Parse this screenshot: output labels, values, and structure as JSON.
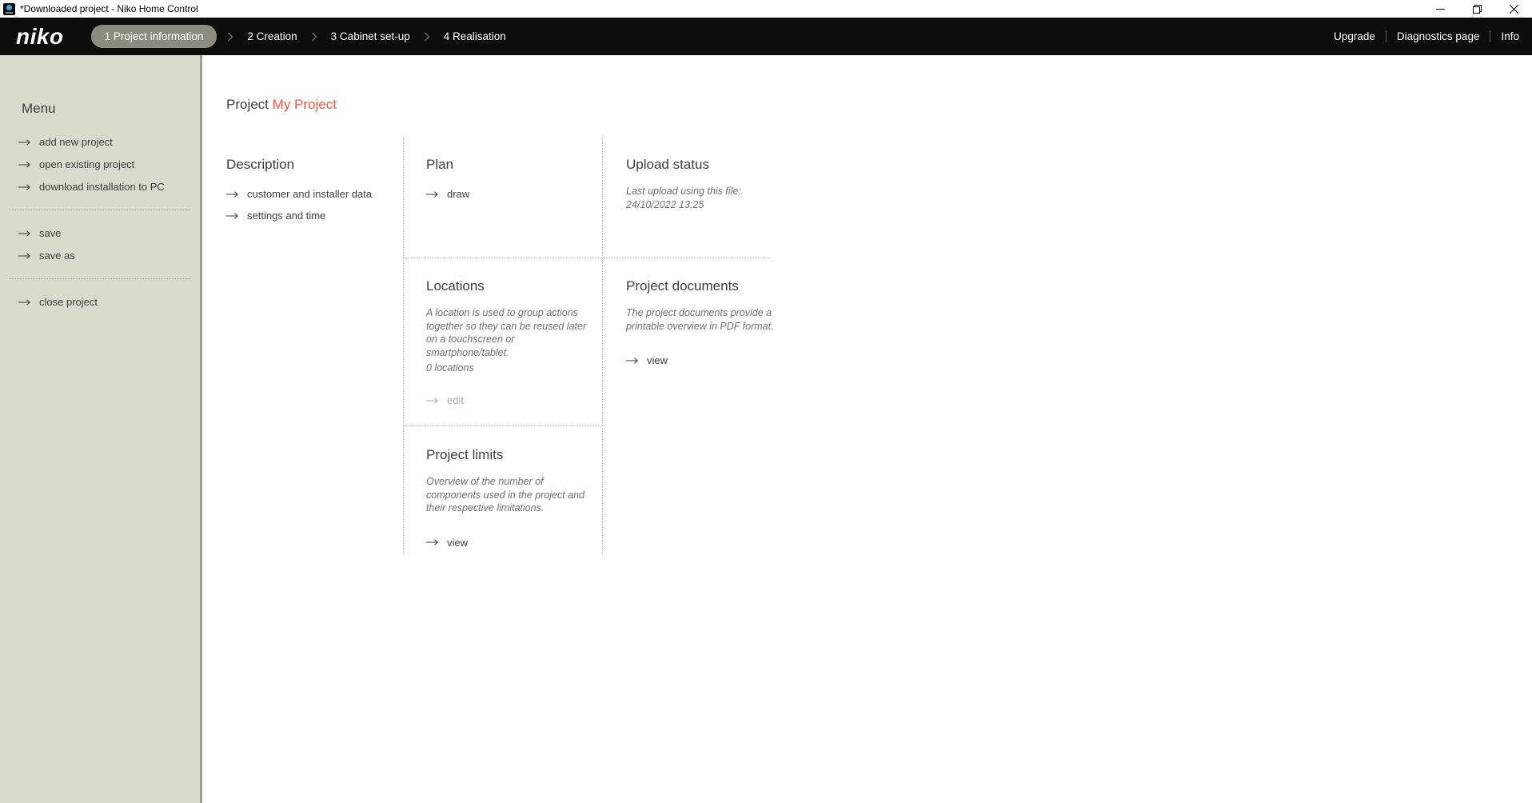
{
  "window": {
    "title": "*Downloaded project - Niko Home Control"
  },
  "nav": {
    "logo": "niko",
    "steps": [
      {
        "label": "1 Project information",
        "active": true
      },
      {
        "label": "2 Creation",
        "active": false
      },
      {
        "label": "3 Cabinet set-up",
        "active": false
      },
      {
        "label": "4 Realisation",
        "active": false
      }
    ],
    "links": [
      {
        "label": "Upgrade"
      },
      {
        "label": "Diagnostics page"
      },
      {
        "label": "Info"
      }
    ]
  },
  "sidebar": {
    "title": "Menu",
    "groups": [
      {
        "items": [
          {
            "label": "add new project"
          },
          {
            "label": "open existing project"
          },
          {
            "label": "download installation to PC"
          }
        ]
      },
      {
        "items": [
          {
            "label": "save"
          },
          {
            "label": "save as"
          }
        ]
      },
      {
        "items": [
          {
            "label": "close project"
          }
        ]
      }
    ]
  },
  "main": {
    "title_prefix": "Project",
    "title_name": "My Project",
    "description": {
      "title": "Description",
      "links": [
        {
          "label": "customer and installer data"
        },
        {
          "label": "settings and time"
        }
      ]
    },
    "plan": {
      "title": "Plan",
      "link": "draw"
    },
    "upload_status": {
      "title": "Upload status",
      "line1": "Last upload using this file:",
      "line2": "24/10/2022 13:25"
    },
    "locations": {
      "title": "Locations",
      "description": "A location is used to group actions together so they can be reused later on a touchscreen or smartphone/tablet.",
      "count": "0 locations",
      "link": "edit"
    },
    "project_documents": {
      "title": "Project documents",
      "description": "The project documents provide a printable overview in PDF format.",
      "link": "view"
    },
    "project_limits": {
      "title": "Project limits",
      "description": "Overview of the number of components used in the project and their respective limitations.",
      "link": "view"
    }
  },
  "colors": {
    "accent": "#fa5440",
    "nav_bg": "#0d0d0d",
    "active_step_bg": "#8d8b7e",
    "sidebar_bg": "#dcdacc",
    "text_dark": "#3d3d3c",
    "text_italic": "#6d6d6c",
    "disabled_link": "#a9a8a5"
  },
  "icons": {
    "app_icon": "niko-blue-dot-square",
    "minimize": "–",
    "restore": "❐",
    "close": "✕",
    "step_separator": "›",
    "link_arrow": "⟶"
  }
}
